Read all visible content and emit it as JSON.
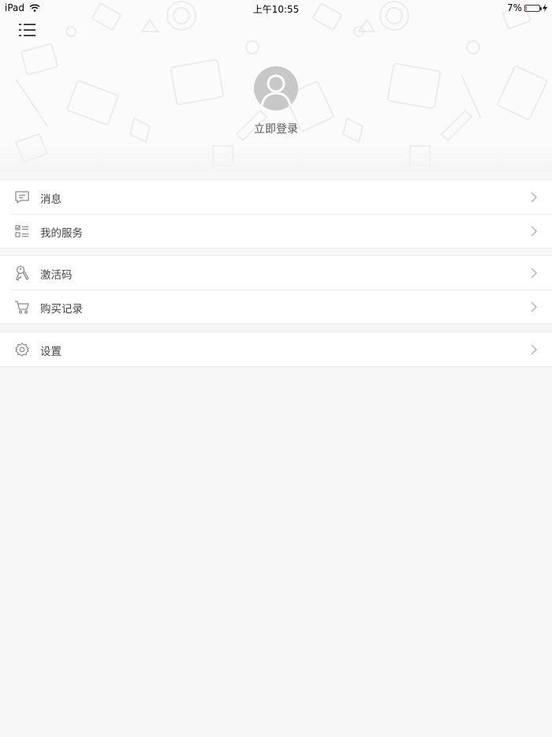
{
  "status_bar": {
    "device": "iPad",
    "time": "上午10:55",
    "battery_percent": "7%",
    "battery_level": 0.07
  },
  "header": {
    "login_label": "立即登录"
  },
  "menu_groups": [
    {
      "items": [
        {
          "label": "消息",
          "icon": "message-icon"
        },
        {
          "label": "我的服务",
          "icon": "service-list-icon"
        }
      ]
    },
    {
      "items": [
        {
          "label": "激活码",
          "icon": "key-icon"
        },
        {
          "label": "购买记录",
          "icon": "cart-icon"
        }
      ]
    },
    {
      "items": [
        {
          "label": "设置",
          "icon": "gear-icon"
        }
      ]
    }
  ],
  "colors": {
    "background": "#f7f7f7",
    "row_background": "#ffffff",
    "icon_gray": "#8a8a8a",
    "battery_red": "#e8433b"
  }
}
